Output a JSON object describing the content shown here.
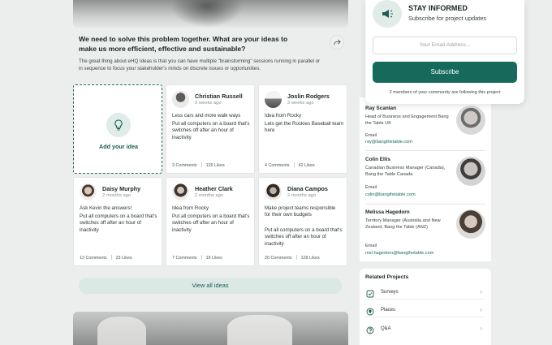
{
  "question": {
    "title": "We need to solve this problem together. What are your ideas to make us more efficient, effective and sustainable?",
    "description": "The great thing about eHQ Ideas is that you can have multiple \"brainstorming\" sessions running in parallel or in sequence to focus your stakeholder's minds on discrete issues or opportunities."
  },
  "add_idea_label": "Add your idea",
  "ideas": [
    {
      "name": "Christian Russell",
      "time": "3 weeks ago",
      "title": "Less cars and more walk ways",
      "body": "Put all computers on a board that's switches off after an hour of inactivity",
      "comments": "3 Comments",
      "likes": "126 Likes"
    },
    {
      "name": "Joslin Rodgers",
      "time": "3 weeks ago",
      "title": "Idea from Rocky",
      "body": "Lets get the Rockies Baseball team here",
      "comments": "4 Comments",
      "likes": "42 Likes"
    },
    {
      "name": "Daisy Murphy",
      "time": "2 months ago",
      "title": "Ask Kevin the answers!",
      "body": "Put all computers on a board that's switches off after an hour of inactivity",
      "comments": "12 Comments",
      "likes": "23 Likes"
    },
    {
      "name": "Heather Clark",
      "time": "2 months ago",
      "title": "Idea from Rocky",
      "body": "Put all computers on a board that's switches off after an hour of inactivity",
      "comments": "7 Comments",
      "likes": "19 Likes"
    },
    {
      "name": "Diana Campos",
      "time": "2 months ago",
      "title": "Make project teams responsible for their own budgets",
      "body": "Put all computers on a board that's switches off after an hour of inactivity",
      "comments": "20 Comments",
      "likes": "128 Likes"
    }
  ],
  "view_all_label": "View all ideas",
  "stay_informed": {
    "title": "STAY INFORMED",
    "subtitle": "Subscribe for project updates",
    "email_placeholder": "Your Email Address...",
    "subscribe_label": "Subscribe",
    "followers_text": "2 members of your community are following this project"
  },
  "contacts": [
    {
      "name": "Ray Scanlan",
      "role": "Head of Business and Engagement Bang the Table UK",
      "email_label": "Email",
      "email": "ray@bangthetable.com"
    },
    {
      "name": "Colin Ellis",
      "role": "Canadian Business Manager (Canada), Bang the Table Canada",
      "email_label": "Email",
      "email": "colin@bangthetable.com"
    },
    {
      "name": "Melissa Hagedorn",
      "role": "Territory Manager (Australia and New Zealand, Bang the Table (ANZ)",
      "email_label": "Email",
      "email": "mel.hagedorn@bangthetable.com"
    }
  ],
  "related_projects": {
    "title": "Related Projects",
    "items": [
      {
        "label": "Surveys",
        "icon": "checklist-icon"
      },
      {
        "label": "Places",
        "icon": "map-pin-icon"
      },
      {
        "label": "Q&A",
        "icon": "question-icon"
      }
    ]
  },
  "colors": {
    "accent": "#156a5c",
    "accent_light": "#dbe8e4"
  }
}
